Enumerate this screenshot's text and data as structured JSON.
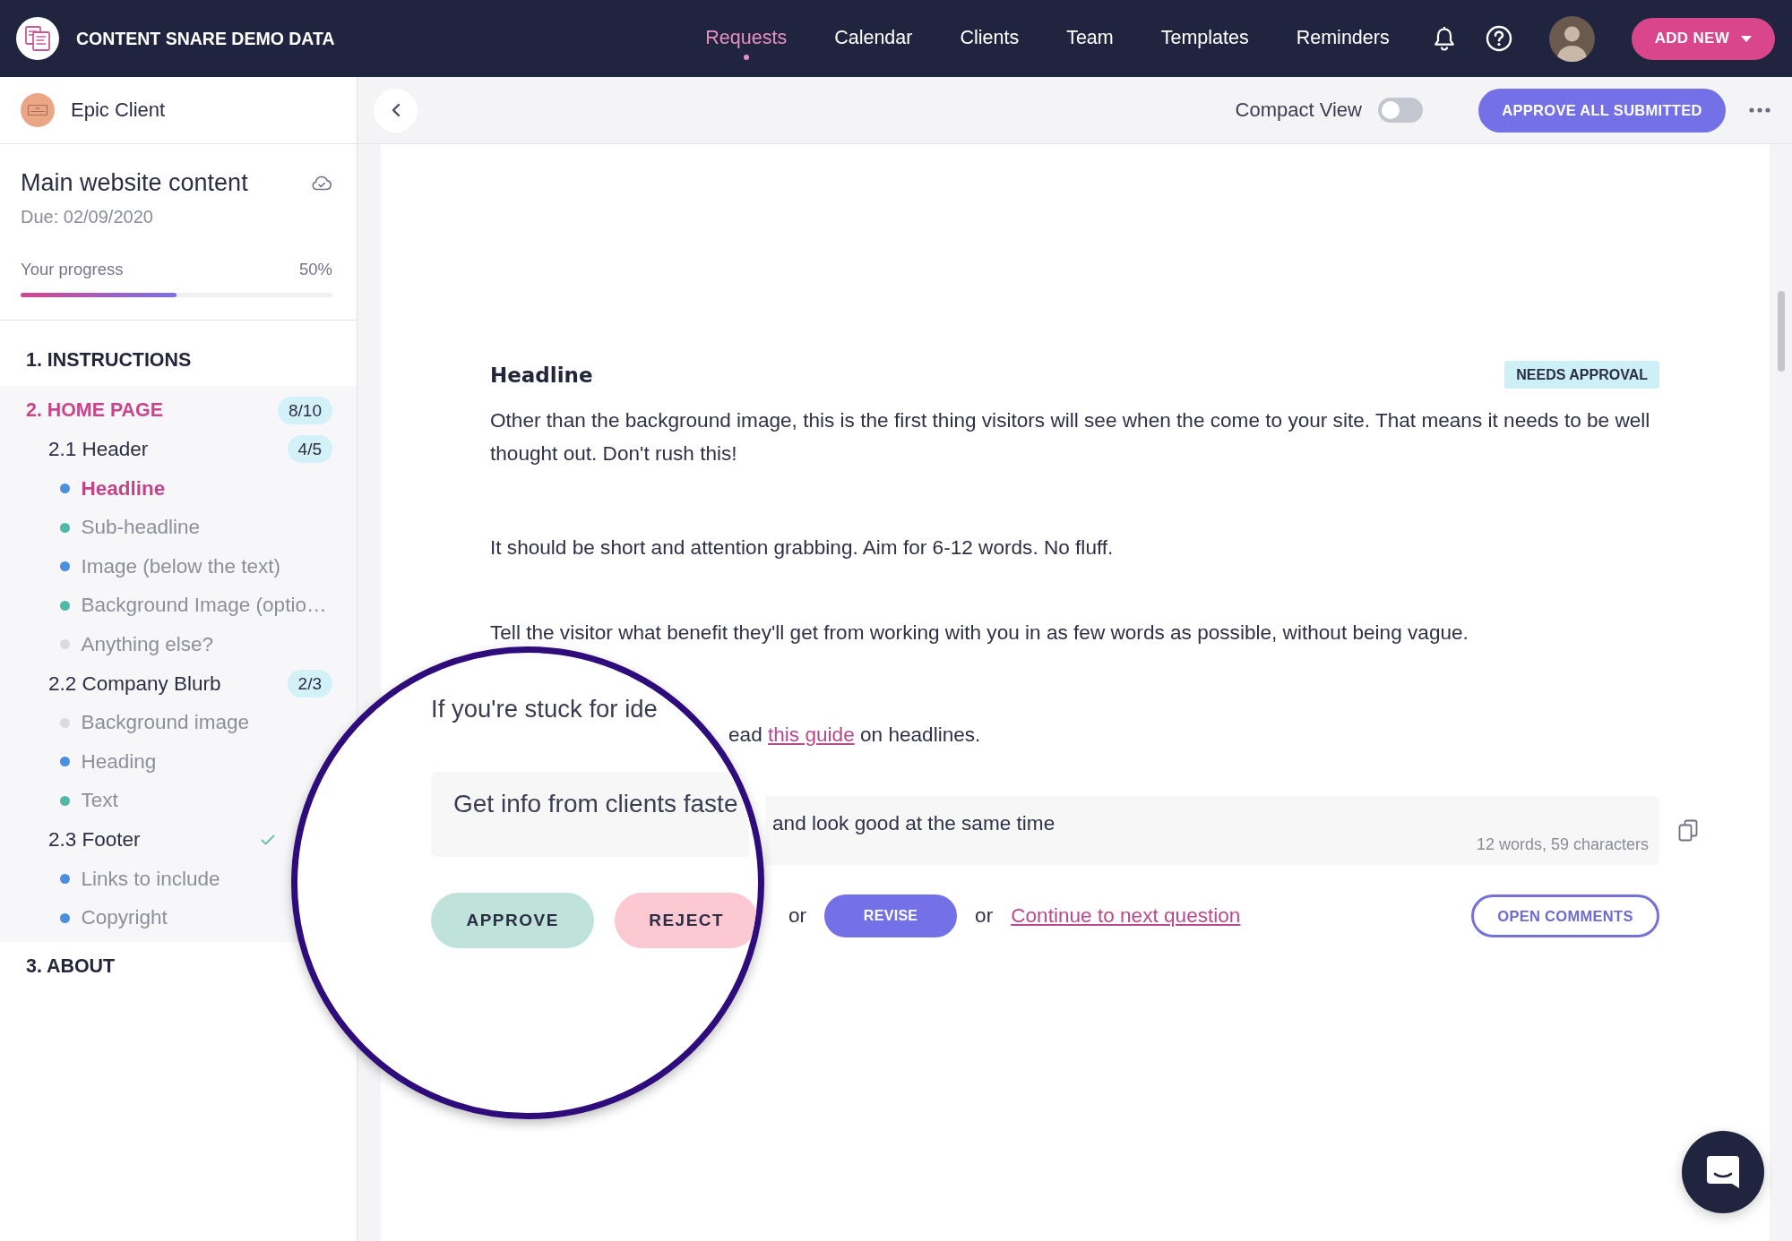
{
  "header": {
    "title": "CONTENT SNARE DEMO DATA",
    "nav": [
      {
        "label": "Requests",
        "selected": true
      },
      {
        "label": "Calendar",
        "selected": false
      },
      {
        "label": "Clients",
        "selected": false
      },
      {
        "label": "Team",
        "selected": false
      },
      {
        "label": "Templates",
        "selected": false
      },
      {
        "label": "Reminders",
        "selected": false
      }
    ],
    "add_button": "ADD NEW"
  },
  "sidebar": {
    "client": "Epic Client",
    "request": {
      "title": "Main website content",
      "due": "Due: 02/09/2020"
    },
    "progress": {
      "label": "Your progress",
      "reading": "50%",
      "level": 0.5
    },
    "sections": [
      {
        "label": "1. INSTRUCTIONS",
        "selected": false
      },
      {
        "label": "2. HOME PAGE",
        "selected": true,
        "count": "8/10",
        "children": [
          {
            "label": "2.1 Header",
            "count": "4/5",
            "complete": false,
            "children": [
              {
                "label": "Headline",
                "color": "#4a8fe0",
                "selected": true
              },
              {
                "label": "Sub-headline",
                "color": "#4fb8a6",
                "selected": false
              },
              {
                "label": "Image (below the text)",
                "color": "#4a8fe0",
                "selected": false
              },
              {
                "label": "Background Image (optio…",
                "color": "#4fb8a6",
                "selected": false
              },
              {
                "label": "Anything else?",
                "color": "#dcdce0",
                "selected": false
              }
            ]
          },
          {
            "label": "2.2 Company Blurb",
            "count": "2/3",
            "complete": false,
            "children": [
              {
                "label": "Background image",
                "color": "#dcdce0",
                "selected": false
              },
              {
                "label": "Heading",
                "color": "#4a8fe0",
                "selected": false
              },
              {
                "label": "Text",
                "color": "#4fb8a6",
                "selected": false
              }
            ]
          },
          {
            "label": "2.3 Footer",
            "complete": true,
            "children": [
              {
                "label": "Links to include",
                "color": "#4a8fe0",
                "selected": false
              },
              {
                "label": "Copyright",
                "color": "#4a8fe0",
                "selected": false
              }
            ]
          }
        ]
      },
      {
        "label": "3. ABOUT",
        "selected": false
      }
    ]
  },
  "toolbar": {
    "compact_view": {
      "label": "Compact View",
      "on": false
    },
    "approve_all": "APPROVE ALL SUBMITTED"
  },
  "question": {
    "title": "Headline",
    "status": "NEEDS APPROVAL",
    "paragraphs": [
      "Other than the background image, this is the first thing visitors will see when the come to your site. That means it needs to be well thought out. Don't rush this!",
      "It should be short and attention grabbing. Aim for 6-12 words. No fluff.",
      "Tell the visitor what benefit they'll get from working with you in as few words as possible, without being vague."
    ],
    "guide": {
      "before": "ead ",
      "link": "this guide",
      "after": " on headlines."
    },
    "answer": {
      "value": "and look good at the same time",
      "counter": "12 words, 59 characters"
    },
    "actions": [
      {
        "kind": "text",
        "label": "or"
      },
      {
        "kind": "button",
        "label": "REVISE"
      },
      {
        "kind": "text",
        "label": "or"
      },
      {
        "kind": "link",
        "label": "Continue to next question"
      }
    ],
    "open_comments": "OPEN COMMENTS"
  },
  "magnifier": {
    "heading": "If you're stuck for ide",
    "answer": "Get info from clients faste",
    "buttons": [
      {
        "kind": "approve",
        "label": "APPROVE"
      },
      {
        "kind": "reject",
        "label": "REJECT"
      }
    ]
  }
}
